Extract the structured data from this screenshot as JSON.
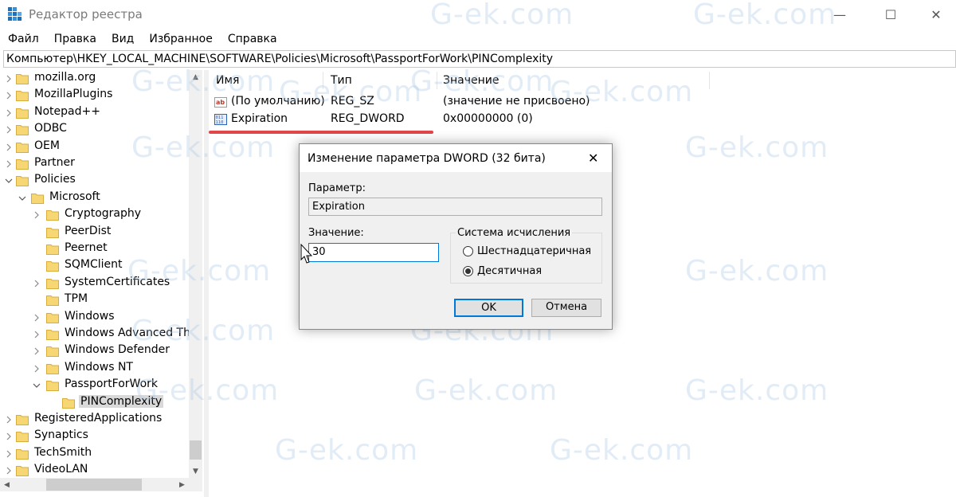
{
  "window": {
    "title": "Редактор реестра"
  },
  "menu": [
    "Файл",
    "Правка",
    "Вид",
    "Избранное",
    "Справка"
  ],
  "address": "Компьютер\\HKEY_LOCAL_MACHINE\\SOFTWARE\\Policies\\Microsoft\\PassportForWork\\PINComplexity",
  "tree": [
    {
      "label": "mozilla.org",
      "level": 0,
      "expand": "collapsed"
    },
    {
      "label": "MozillaPlugins",
      "level": 0,
      "expand": "collapsed"
    },
    {
      "label": "Notepad++",
      "level": 0,
      "expand": "collapsed"
    },
    {
      "label": "ODBC",
      "level": 0,
      "expand": "collapsed"
    },
    {
      "label": "OEM",
      "level": 0,
      "expand": "collapsed"
    },
    {
      "label": "Partner",
      "level": 0,
      "expand": "collapsed"
    },
    {
      "label": "Policies",
      "level": 0,
      "expand": "expanded"
    },
    {
      "label": "Microsoft",
      "level": 1,
      "expand": "expanded"
    },
    {
      "label": "Cryptography",
      "level": 2,
      "expand": "collapsed"
    },
    {
      "label": "PeerDist",
      "level": 2,
      "expand": "none"
    },
    {
      "label": "Peernet",
      "level": 2,
      "expand": "none"
    },
    {
      "label": "SQMClient",
      "level": 2,
      "expand": "none"
    },
    {
      "label": "SystemCertificates",
      "level": 2,
      "expand": "collapsed"
    },
    {
      "label": "TPM",
      "level": 2,
      "expand": "none"
    },
    {
      "label": "Windows",
      "level": 2,
      "expand": "collapsed"
    },
    {
      "label": "Windows Advanced Thre",
      "level": 2,
      "expand": "collapsed"
    },
    {
      "label": "Windows Defender",
      "level": 2,
      "expand": "collapsed"
    },
    {
      "label": "Windows NT",
      "level": 2,
      "expand": "collapsed"
    },
    {
      "label": "PassportForWork",
      "level": 2,
      "expand": "expanded"
    },
    {
      "label": "PINComplexity",
      "level": 3,
      "expand": "none",
      "selected": true
    },
    {
      "label": "RegisteredApplications",
      "level": 0,
      "expand": "collapsed"
    },
    {
      "label": "Synaptics",
      "level": 0,
      "expand": "collapsed"
    },
    {
      "label": "TechSmith",
      "level": 0,
      "expand": "collapsed"
    },
    {
      "label": "VideoLAN",
      "level": 0,
      "expand": "collapsed"
    }
  ],
  "list": {
    "columns": [
      "Имя",
      "Тип",
      "Значение"
    ],
    "rows": [
      {
        "icon": "string-value-icon",
        "name": "(По умолчанию)",
        "type": "REG_SZ",
        "value": "(значение не присвоено)"
      },
      {
        "icon": "dword-value-icon",
        "name": "Expiration",
        "type": "REG_DWORD",
        "value": "0x00000000 (0)"
      }
    ]
  },
  "watermark": "G-ek.com",
  "dialog": {
    "title": "Изменение параметра DWORD (32 бита)",
    "param_label": "Параметр:",
    "param_value": "Expiration",
    "value_label": "Значение:",
    "value": "30",
    "base_label": "Система исчисления",
    "radio_hex": "Шестнадцатеричная",
    "radio_dec": "Десятичная",
    "selected_base": "dec",
    "ok": "OK",
    "cancel": "Отмена"
  },
  "colors": {
    "highlight": "#e0464a",
    "accent": "#0078d7",
    "folder": "#f7d774"
  }
}
